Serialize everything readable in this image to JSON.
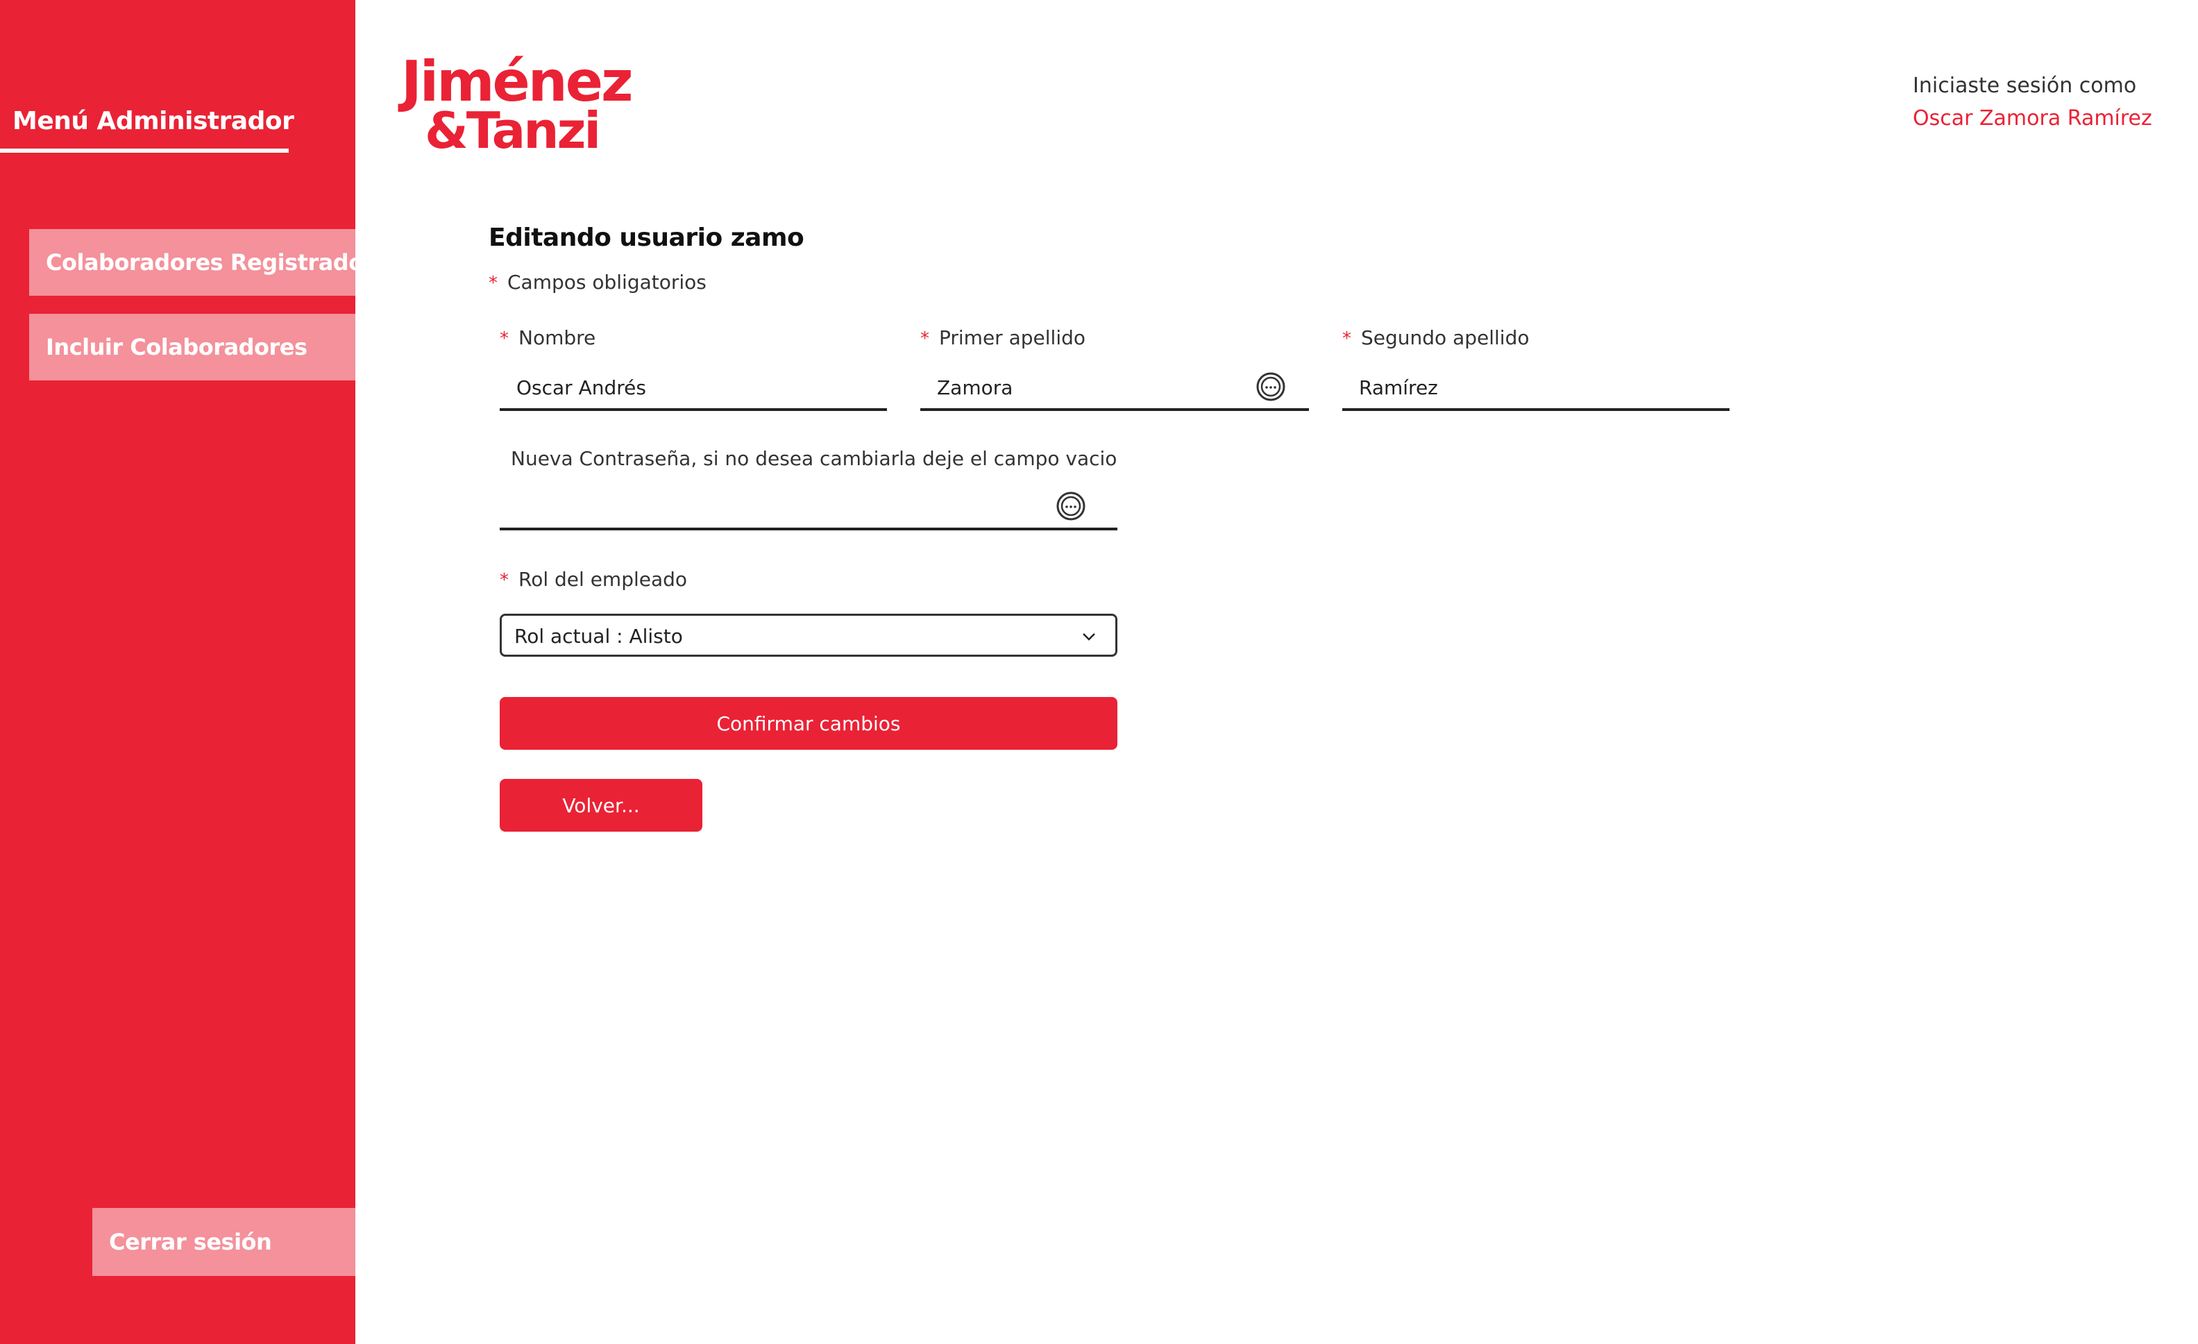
{
  "sidebar": {
    "title": "Menú Administrador",
    "items": [
      {
        "label": "Colaboradores Registrados"
      },
      {
        "label": "Incluir Colaboradores"
      }
    ],
    "logout_label": "Cerrar sesión"
  },
  "header": {
    "logo_line1": "Jiménez",
    "logo_line2": "&Tanzi",
    "session_label": "Iniciaste sesión como",
    "session_user": "Oscar Zamora Ramírez"
  },
  "form": {
    "title": "Editando usuario zamo",
    "required_star": "*",
    "required_note": "Campos obligatorios",
    "fields": {
      "nombre": {
        "label": "Nombre",
        "value": "Oscar Andrés"
      },
      "primer_apellido": {
        "label": "Primer apellido",
        "value": "Zamora"
      },
      "segundo_apellido": {
        "label": "Segundo apellido",
        "value": "Ramírez"
      },
      "password": {
        "label": "Nueva Contraseña, si no desea cambiarla deje el campo vacio",
        "value": ""
      },
      "rol": {
        "label": "Rol del empleado",
        "selected": "Rol actual : Alisto"
      }
    },
    "confirm_label": "Confirmar cambios",
    "back_label": "Volver..."
  },
  "colors": {
    "accent": "#ea2235",
    "menu_item_bg": "#f4919b"
  },
  "icons": [
    "password-reveal-icon",
    "chevron-down-icon"
  ]
}
